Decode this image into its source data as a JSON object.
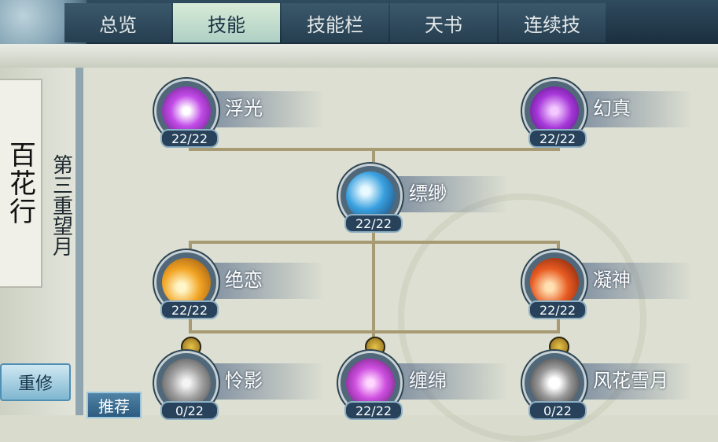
{
  "tabs": [
    {
      "label": "总览"
    },
    {
      "label": "技能"
    },
    {
      "label": "技能栏"
    },
    {
      "label": "天书"
    },
    {
      "label": "连续技"
    }
  ],
  "sidebar": {
    "sect_name": "百花行",
    "realm": "第三重望月",
    "reset_label": "重修",
    "recommend_label": "推荐"
  },
  "skills": [
    {
      "name": "浮光",
      "level": "22/22",
      "color": "#b032e0"
    },
    {
      "name": "幻真",
      "level": "22/22",
      "color": "#9b2fd6"
    },
    {
      "name": "缥缈",
      "level": "22/22",
      "color": "#2f86c8"
    },
    {
      "name": "绝恋",
      "level": "22/22",
      "color": "#f0a21f"
    },
    {
      "name": "凝神",
      "level": "22/22",
      "color": "#e2551f"
    },
    {
      "name": "怜影",
      "level": "0/22",
      "color": "#a9a9a9"
    },
    {
      "name": "缠绵",
      "level": "22/22",
      "color": "#c74fd6"
    },
    {
      "name": "风花雪月",
      "level": "0/22",
      "color": "#8a8a8a"
    }
  ],
  "locks": [
    {
      "icon": "lock-icon-1"
    },
    {
      "icon": "lock-icon-2"
    },
    {
      "icon": "lock-icon-3"
    }
  ]
}
